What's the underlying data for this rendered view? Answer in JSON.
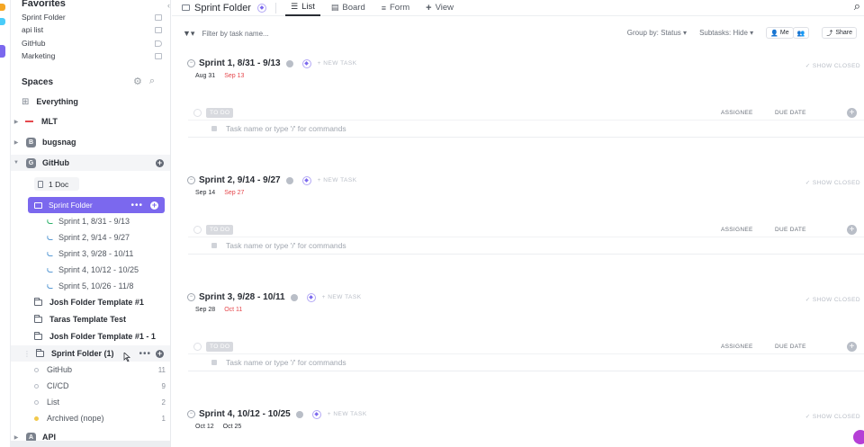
{
  "sidebar": {
    "favorites_title": "Favorites",
    "favorites": [
      {
        "label": "Sprint Folder",
        "icon": "folder-icon"
      },
      {
        "label": "api list",
        "icon": "list-icon"
      },
      {
        "label": "GitHub",
        "icon": "tag-icon"
      },
      {
        "label": "Marketing",
        "icon": "grid-icon"
      }
    ],
    "spaces_title": "Spaces",
    "everything": "Everything",
    "spaces": {
      "mlt": "MLT",
      "bugsnag": "bugsnag",
      "bugsnag_initial": "B",
      "github": "GitHub",
      "github_initial": "G",
      "api": "API",
      "api_initial": "A"
    },
    "doc_badge": "1 Doc",
    "active_folder": "Sprint Folder",
    "sprints": [
      "Sprint 1, 8/31 - 9/13",
      "Sprint 2, 9/14 - 9/27",
      "Sprint 3, 9/28 - 10/11",
      "Sprint 4, 10/12 - 10/25",
      "Sprint 5, 10/26 - 11/8"
    ],
    "folders": [
      "Josh Folder Template #1",
      "Taras Template Test",
      "Josh Folder Template #1 - 1"
    ],
    "sprint_folder_1": "Sprint Folder (1)",
    "lists": [
      {
        "label": "GitHub",
        "count": "11"
      },
      {
        "label": "CI/CD",
        "count": "9"
      },
      {
        "label": "List",
        "count": "2"
      },
      {
        "label": "Archived (nope)",
        "count": "1"
      }
    ]
  },
  "main": {
    "breadcrumb": "Sprint Folder",
    "tabs": [
      "List",
      "Board",
      "Form",
      "View"
    ],
    "filter_placeholder": "Filter by task name...",
    "group_by_label": "Group by:",
    "group_by_value": "Status",
    "subtasks_label": "Subtasks:",
    "subtasks_value": "Hide",
    "me_label": "Me",
    "share_label": "Share",
    "new_task": "+ NEW TASK",
    "show_closed": "SHOW CLOSED",
    "status": "TO DO",
    "col_assignee": "ASSIGNEE",
    "col_due": "DUE DATE",
    "task_placeholder": "Task name or type '/' for commands",
    "sprints": [
      {
        "title": "Sprint 1, 8/31 - 9/13",
        "start": "Aug 31",
        "end": "Sep 13"
      },
      {
        "title": "Sprint 2, 9/14 - 9/27",
        "start": "Sep 14",
        "end": "Sep 27"
      },
      {
        "title": "Sprint 3, 9/28 - 10/11",
        "start": "Sep 28",
        "end": "Oct 11"
      },
      {
        "title": "Sprint 4, 10/12 - 10/25",
        "start": "Oct 12",
        "end": "Oct 25"
      }
    ]
  },
  "colors": {
    "accent": "#7b68ee",
    "overdue": "#e5484d",
    "sprint_green": "#2fb26b",
    "sprint_blue": "#5b9bd5"
  }
}
